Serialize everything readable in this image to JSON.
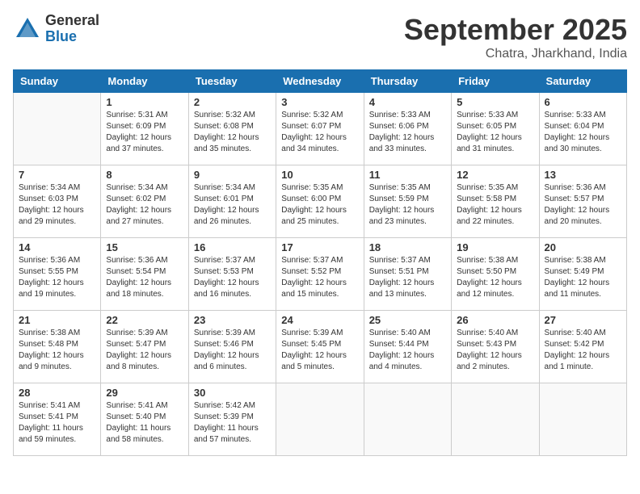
{
  "logo": {
    "general": "General",
    "blue": "Blue"
  },
  "header": {
    "month": "September 2025",
    "location": "Chatra, Jharkhand, India"
  },
  "weekdays": [
    "Sunday",
    "Monday",
    "Tuesday",
    "Wednesday",
    "Thursday",
    "Friday",
    "Saturday"
  ],
  "weeks": [
    [
      {
        "day": "",
        "info": ""
      },
      {
        "day": "1",
        "info": "Sunrise: 5:31 AM\nSunset: 6:09 PM\nDaylight: 12 hours\nand 37 minutes."
      },
      {
        "day": "2",
        "info": "Sunrise: 5:32 AM\nSunset: 6:08 PM\nDaylight: 12 hours\nand 35 minutes."
      },
      {
        "day": "3",
        "info": "Sunrise: 5:32 AM\nSunset: 6:07 PM\nDaylight: 12 hours\nand 34 minutes."
      },
      {
        "day": "4",
        "info": "Sunrise: 5:33 AM\nSunset: 6:06 PM\nDaylight: 12 hours\nand 33 minutes."
      },
      {
        "day": "5",
        "info": "Sunrise: 5:33 AM\nSunset: 6:05 PM\nDaylight: 12 hours\nand 31 minutes."
      },
      {
        "day": "6",
        "info": "Sunrise: 5:33 AM\nSunset: 6:04 PM\nDaylight: 12 hours\nand 30 minutes."
      }
    ],
    [
      {
        "day": "7",
        "info": "Sunrise: 5:34 AM\nSunset: 6:03 PM\nDaylight: 12 hours\nand 29 minutes."
      },
      {
        "day": "8",
        "info": "Sunrise: 5:34 AM\nSunset: 6:02 PM\nDaylight: 12 hours\nand 27 minutes."
      },
      {
        "day": "9",
        "info": "Sunrise: 5:34 AM\nSunset: 6:01 PM\nDaylight: 12 hours\nand 26 minutes."
      },
      {
        "day": "10",
        "info": "Sunrise: 5:35 AM\nSunset: 6:00 PM\nDaylight: 12 hours\nand 25 minutes."
      },
      {
        "day": "11",
        "info": "Sunrise: 5:35 AM\nSunset: 5:59 PM\nDaylight: 12 hours\nand 23 minutes."
      },
      {
        "day": "12",
        "info": "Sunrise: 5:35 AM\nSunset: 5:58 PM\nDaylight: 12 hours\nand 22 minutes."
      },
      {
        "day": "13",
        "info": "Sunrise: 5:36 AM\nSunset: 5:57 PM\nDaylight: 12 hours\nand 20 minutes."
      }
    ],
    [
      {
        "day": "14",
        "info": "Sunrise: 5:36 AM\nSunset: 5:55 PM\nDaylight: 12 hours\nand 19 minutes."
      },
      {
        "day": "15",
        "info": "Sunrise: 5:36 AM\nSunset: 5:54 PM\nDaylight: 12 hours\nand 18 minutes."
      },
      {
        "day": "16",
        "info": "Sunrise: 5:37 AM\nSunset: 5:53 PM\nDaylight: 12 hours\nand 16 minutes."
      },
      {
        "day": "17",
        "info": "Sunrise: 5:37 AM\nSunset: 5:52 PM\nDaylight: 12 hours\nand 15 minutes."
      },
      {
        "day": "18",
        "info": "Sunrise: 5:37 AM\nSunset: 5:51 PM\nDaylight: 12 hours\nand 13 minutes."
      },
      {
        "day": "19",
        "info": "Sunrise: 5:38 AM\nSunset: 5:50 PM\nDaylight: 12 hours\nand 12 minutes."
      },
      {
        "day": "20",
        "info": "Sunrise: 5:38 AM\nSunset: 5:49 PM\nDaylight: 12 hours\nand 11 minutes."
      }
    ],
    [
      {
        "day": "21",
        "info": "Sunrise: 5:38 AM\nSunset: 5:48 PM\nDaylight: 12 hours\nand 9 minutes."
      },
      {
        "day": "22",
        "info": "Sunrise: 5:39 AM\nSunset: 5:47 PM\nDaylight: 12 hours\nand 8 minutes."
      },
      {
        "day": "23",
        "info": "Sunrise: 5:39 AM\nSunset: 5:46 PM\nDaylight: 12 hours\nand 6 minutes."
      },
      {
        "day": "24",
        "info": "Sunrise: 5:39 AM\nSunset: 5:45 PM\nDaylight: 12 hours\nand 5 minutes."
      },
      {
        "day": "25",
        "info": "Sunrise: 5:40 AM\nSunset: 5:44 PM\nDaylight: 12 hours\nand 4 minutes."
      },
      {
        "day": "26",
        "info": "Sunrise: 5:40 AM\nSunset: 5:43 PM\nDaylight: 12 hours\nand 2 minutes."
      },
      {
        "day": "27",
        "info": "Sunrise: 5:40 AM\nSunset: 5:42 PM\nDaylight: 12 hours\nand 1 minute."
      }
    ],
    [
      {
        "day": "28",
        "info": "Sunrise: 5:41 AM\nSunset: 5:41 PM\nDaylight: 11 hours\nand 59 minutes."
      },
      {
        "day": "29",
        "info": "Sunrise: 5:41 AM\nSunset: 5:40 PM\nDaylight: 11 hours\nand 58 minutes."
      },
      {
        "day": "30",
        "info": "Sunrise: 5:42 AM\nSunset: 5:39 PM\nDaylight: 11 hours\nand 57 minutes."
      },
      {
        "day": "",
        "info": ""
      },
      {
        "day": "",
        "info": ""
      },
      {
        "day": "",
        "info": ""
      },
      {
        "day": "",
        "info": ""
      }
    ]
  ]
}
